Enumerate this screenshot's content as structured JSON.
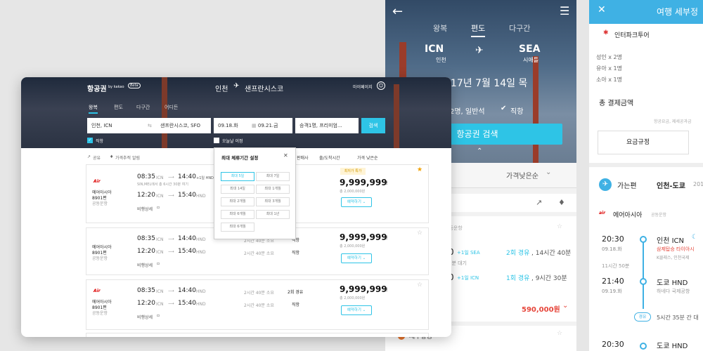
{
  "mobile_search": {
    "tabs": [
      "왕복",
      "편도",
      "다구간"
    ],
    "origin_code": "ICN",
    "origin_city": "인천",
    "dest_code": "SEA",
    "dest_city": "시애틀",
    "date": "017년 7월 14일 목",
    "passenger_class": "2명, 일반석",
    "direct_label": "직항",
    "search_button": "항공권 검색",
    "sort_label": "가격낮은순",
    "airport_label": "공동운항",
    "r1_arr": "0",
    "r1_arr_suffix": "+1일 SEA",
    "r1_stops": "2회 경유",
    "r1_duration": ", 14시간 40분",
    "r1_wait": "0분 대기",
    "r2_arr": "0",
    "r2_arr_suffix": "+1일 ICN",
    "r2_stops": "1회 경유",
    "r2_duration": ", 9시간 30분",
    "price": "590,000원",
    "bottom_label": "제주항공"
  },
  "mobile_detail": {
    "title": "여행 세부정",
    "agency": "인터파크투어",
    "pax_adult": "성인 x 2명",
    "pax_child": "유아 x 1명",
    "pax_infant": "소아 x 1명",
    "total_label": "총 결제금액",
    "fare_note": "항공요금, 제세공과금",
    "fare_rules_button": "요금규정",
    "outbound_label": "가는편",
    "outbound_route": "인천-도쿄",
    "outbound_year": "201",
    "airline": "에어아시아",
    "airline_note": "공동운항",
    "dep_time": "20:30",
    "dep_date": "09.18.화",
    "dep_place": "인천 ICN",
    "dep_terminal": "삼제탑승 타이아시",
    "dep_class": "K클래스, 인천국제",
    "duration": "11시간 50분",
    "arr_time": "21:40",
    "arr_date": "09.19.화",
    "arr_place": "도쿄 HND",
    "arr_airport": "하네다 국제공항",
    "layover_badge": "경유",
    "layover_text": "5시간 35분 간 대",
    "next_time": "20:30",
    "next_place": "도쿄 HND"
  },
  "desktop": {
    "logo": "항공권",
    "logo_by": "by kakao",
    "logo_badge": "Beta",
    "route_from": "인천",
    "route_to": "샌프란시스코",
    "my_page": "마이페이지",
    "tabs": [
      "왕복",
      "편도",
      "다구간",
      "어디든"
    ],
    "origin": "인천, ICN",
    "destination": "샌프란시스코, SFO",
    "dep_date": "09.18.화",
    "ret_date": "09.21.금",
    "passengers": "승객1명, 프리미엄...",
    "search_button": "검색",
    "direct_check": "직항",
    "today_check": "오늘날 이정",
    "share": "공유",
    "price_alert": "가격추적 알림",
    "filter_carrier": "판매사",
    "filter_time": "출/도착시간",
    "filter_sort": "가격 낮은순",
    "popup": {
      "title": "최대 체류기간 설정",
      "options": [
        "최대 5일",
        "최대 7일",
        "최대 14일",
        "최대 1개월",
        "최대 2개월",
        "최대 3개월",
        "최대 6개월",
        "최대 1년",
        "최대 6개월"
      ]
    },
    "results": [
      {
        "airline": "에어아시아",
        "flight": "8901편",
        "note": "공동운항",
        "dep1": "08:35",
        "dep1_code": "ICN",
        "arr1": "14:40",
        "arr1_code": "+1일 HND",
        "layover": "SIN,MEL에서 총 6시간 30분 여기",
        "dep2": "12:20",
        "dep2_code": "ICN",
        "arr2": "15:40",
        "arr2_code": "HND",
        "detail": "비행상세",
        "badge": "최저가 특가",
        "price": "9,999,999",
        "price_unit": "원",
        "price_sub": "총 2,000,000원",
        "reserve": "예약하기",
        "starred": true
      },
      {
        "airline": "에어아시아",
        "flight": "8901편",
        "note": "공동운항",
        "dep1": "08:35",
        "dep1_code": "ICN",
        "arr1": "14:40",
        "arr1_code": "HND",
        "duration1": "2시간 40분 소요",
        "stops1": "직항",
        "dep2": "12:20",
        "dep2_code": "ICN",
        "arr2": "15:40",
        "arr2_code": "HND",
        "duration2": "2시간 40분 소요",
        "stops2": "직항",
        "detail": "비행상세",
        "price": "9,999,999",
        "price_unit": "원",
        "price_sub": "총 2,000,000원",
        "reserve": "예약하기",
        "starred": false
      },
      {
        "airline": "에어아시아",
        "flight": "8901편",
        "note": "공동운항",
        "dep1": "08:35",
        "dep1_code": "ICN",
        "arr1": "14:40",
        "arr1_code": "HND",
        "duration1": "2시간 40분 소요",
        "stops1": "2회 경유",
        "dep2": "12:20",
        "dep2_code": "ICN",
        "arr2": "15:40",
        "arr2_code": "HND",
        "duration2": "2시간 40분 소요",
        "stops2": "직항",
        "detail": "비행상세",
        "price": "9,999,999",
        "price_unit": "원",
        "price_sub": "총 2,000,000원",
        "reserve": "예약하기",
        "starred": false
      }
    ]
  },
  "colors": {
    "accent": "#2ec4e6",
    "price_red": "#e6453a",
    "airasia_red": "#d00000"
  }
}
